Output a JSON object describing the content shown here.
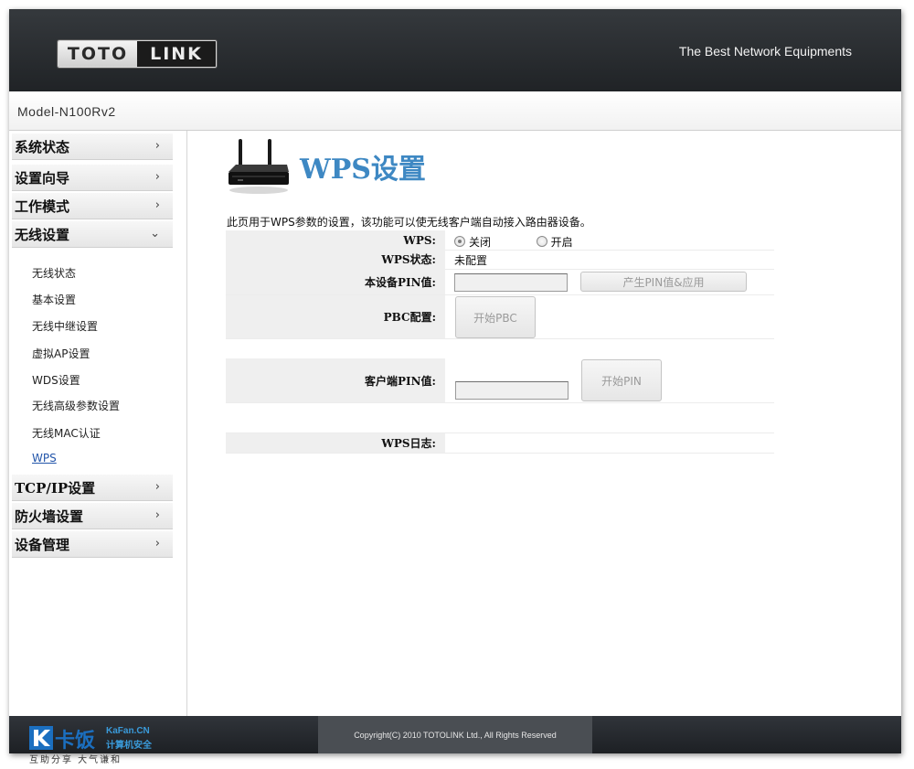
{
  "header": {
    "logo_left": "TOTO",
    "logo_right": "LINK",
    "tagline": "The Best Network Equipments"
  },
  "model": "Model-N100Rv2",
  "sidebar": {
    "groups": [
      {
        "label": "系统状态",
        "chevron": "›"
      },
      {
        "label": "设置向导",
        "chevron": "›"
      },
      {
        "label": "工作模式",
        "chevron": "›"
      },
      {
        "label": "无线设置",
        "chevron": "⌄"
      },
      {
        "label": "TCP/IP设置",
        "chevron": "›"
      },
      {
        "label": "防火墙设置",
        "chevron": "›"
      },
      {
        "label": "设备管理",
        "chevron": "›"
      }
    ],
    "sub_items": [
      "无线状态",
      "基本设置",
      "无线中继设置",
      "虚拟AP设置",
      "WDS设置",
      "无线高级参数设置",
      "无线MAC认证",
      "WPS"
    ]
  },
  "main": {
    "title": "WPS设置",
    "description": "此页用于WPS参数的设置，该功能可以使无线客户端自动接入路由器设备。",
    "wps_label": "WPS:",
    "wps_off": "关闭",
    "wps_on": "开启",
    "status_label": "WPS状态:",
    "status_value": "未配置",
    "pin_label": "本设备PIN值:",
    "pin_value": "",
    "gen_pin_button": "产生PIN值&应用",
    "pbc_label": "PBC配置:",
    "pbc_button": "开始PBC",
    "client_pin_label": "客户端PIN值:",
    "client_pin_value": "",
    "start_pin_button": "开始PIN",
    "log_label": "WPS日志:",
    "log_value": ""
  },
  "footer": {
    "copyright": "Copyright(C) 2010 TOTOLINK Ltd.,   All Rights Reserved"
  },
  "watermark": {
    "brand": "卡饭",
    "site": "KaFan.CN",
    "sub": "计算机安全",
    "slogan": "互助分享  大气谦和"
  }
}
